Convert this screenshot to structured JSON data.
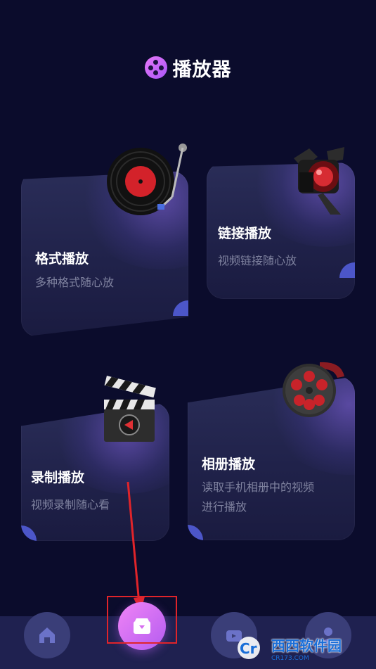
{
  "header": {
    "title": "播放器",
    "logo_icon": "film-reel-icon"
  },
  "cards": [
    {
      "title": "格式播放",
      "subtitle": "多种格式随心放",
      "icon": "vinyl-record-icon"
    },
    {
      "title": "链接播放",
      "subtitle": "视频链接随心放",
      "icon": "stage-spotlight-icon"
    },
    {
      "title": "录制播放",
      "subtitle": "视频录制随心看",
      "icon": "clapperboard-icon"
    },
    {
      "title": "相册播放",
      "subtitle_line1": "读取手机相册中的视频",
      "subtitle_line2": "进行播放",
      "icon": "film-reel-icon"
    }
  ],
  "nav": {
    "items": [
      {
        "icon": "home-icon"
      },
      {
        "icon": "add-video-icon"
      },
      {
        "icon": "camera-icon"
      },
      {
        "icon": "user-icon"
      }
    ]
  },
  "watermark": {
    "main": "西西软件园",
    "sub": "CR173.COM",
    "logo": "Cr"
  },
  "colors": {
    "background": "#0b0c2c",
    "card": "#23254c",
    "accent": "#c06cf2",
    "highlight": "#e0242a"
  }
}
